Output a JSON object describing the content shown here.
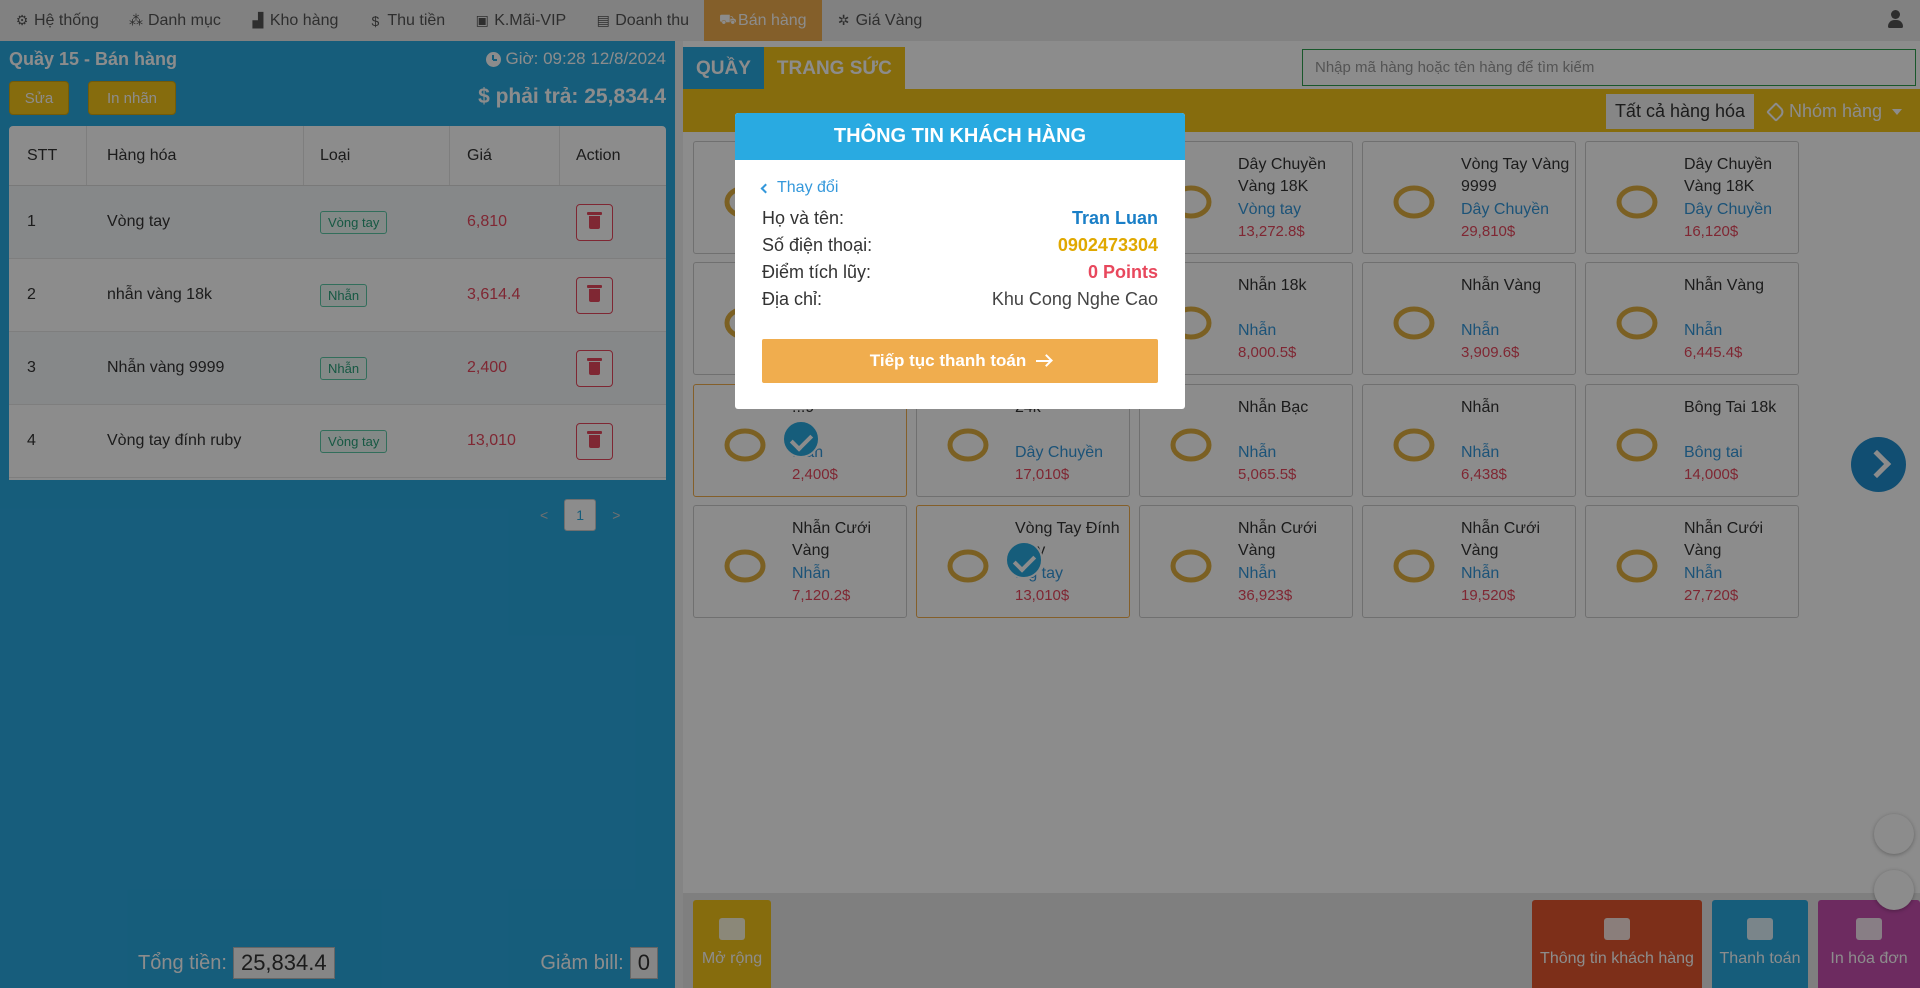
{
  "nav": {
    "items": [
      {
        "label": "Hệ thống",
        "icon": "gear-icon",
        "glyph": "⚙"
      },
      {
        "label": "Danh mục",
        "icon": "cubes-icon",
        "glyph": "⁂"
      },
      {
        "label": "Kho hàng",
        "icon": "industry-icon",
        "glyph": "▟"
      },
      {
        "label": "Thu tiền",
        "icon": "dollar-icon",
        "glyph": "$"
      },
      {
        "label": "K.Mãi-VIP",
        "icon": "gift-icon",
        "glyph": "▣"
      },
      {
        "label": "Doanh thu",
        "icon": "file-icon",
        "glyph": "▤"
      },
      {
        "label": "Bán hàng",
        "icon": "cart-icon",
        "glyph": "⛟"
      },
      {
        "label": "Giá Vàng",
        "icon": "bug-icon",
        "glyph": "✲"
      }
    ],
    "active_index": 6
  },
  "left": {
    "title": "Quầy 15 - Bán hàng",
    "time": "Giờ: 09:28 12/8/2024",
    "edit_label": "Sửa",
    "print_label_label": "In nhãn",
    "pay_due": "$ phải trả: 25,834.4",
    "table": {
      "headers": [
        "STT",
        "Hàng hóa",
        "Loại",
        "Giá",
        "Action"
      ],
      "rows": [
        {
          "stt": "1",
          "name": "Vòng tay",
          "type": "Vòng tay",
          "price": "6,810"
        },
        {
          "stt": "2",
          "name": "nhẫn vàng 18k",
          "type": "Nhẫn",
          "price": "3,614.4"
        },
        {
          "stt": "3",
          "name": "Nhẫn vàng 9999",
          "type": "Nhẫn",
          "price": "2,400"
        },
        {
          "stt": "4",
          "name": "Vòng tay đính ruby",
          "type": "Vòng tay",
          "price": "13,010"
        }
      ]
    },
    "pager": {
      "prev": "<",
      "page": "1",
      "next": ">"
    },
    "total_label": "Tổng tiền:",
    "total_value": "25,834.4",
    "discount_label": "Giảm bill:",
    "discount_value": "0"
  },
  "right": {
    "tab_counter": "QUẦY",
    "tab_jewelry": "TRANG SỨC",
    "search_placeholder": "Nhập mã hàng hoặc tên hàng để tìm kiếm",
    "all_goods": "Tất cả hàng hóa",
    "group_label": "Nhóm hàng",
    "products": [
      {
        "name": "",
        "type": "",
        "price": "",
        "selected": false
      },
      {
        "name": "",
        "type": "",
        "price": "",
        "selected": false
      },
      {
        "name": "Dây Chuyền Vàng 18K",
        "type": "Vòng tay",
        "price": "13,272.8$",
        "selected": false
      },
      {
        "name": "Vòng Tay Vàng 9999",
        "type": "Dây Chuyền",
        "price": "29,810$",
        "selected": false
      },
      {
        "name": "Dây Chuyền Vàng 18K",
        "type": "Dây Chuyền",
        "price": "16,120$",
        "selected": false
      },
      {
        "name": "",
        "type": "",
        "price": "",
        "selected": false
      },
      {
        "name": "",
        "type": "",
        "price": "",
        "selected": false
      },
      {
        "name": "Nhẫn 18k",
        "type": "Nhẫn",
        "price": "8,000.5$",
        "selected": false
      },
      {
        "name": "Nhẫn Vàng",
        "type": "Nhẫn",
        "price": "3,909.6$",
        "selected": false
      },
      {
        "name": "Nhẫn Vàng",
        "type": "Nhẫn",
        "price": "6,445.4$",
        "selected": false
      },
      {
        "name": "...9",
        "type": "...ẫn",
        "price": "2,400$",
        "selected": true
      },
      {
        "name": "24k",
        "type": "Dây Chuyền",
        "price": "17,010$",
        "selected": false
      },
      {
        "name": "Nhẫn Bạc",
        "type": "Nhẫn",
        "price": "5,065.5$",
        "selected": false
      },
      {
        "name": "Nhẫn",
        "type": "Nhẫn",
        "price": "6,438$",
        "selected": false
      },
      {
        "name": "Bông Tai 18k",
        "type": "Bông tai",
        "price": "14,000$",
        "selected": false
      },
      {
        "name": "Nhẫn Cưới Vàng",
        "type": "Nhẫn",
        "price": "7,120.2$",
        "selected": false
      },
      {
        "name": "Vòng Tay Đính ...by",
        "type": "...g tay",
        "price": "13,010$",
        "selected": true
      },
      {
        "name": "Nhẫn Cưới Vàng",
        "type": "Nhẫn",
        "price": "36,923$",
        "selected": false
      },
      {
        "name": "Nhẫn Cưới Vàng",
        "type": "Nhẫn",
        "price": "19,520$",
        "selected": false
      },
      {
        "name": "Nhẫn Cưới Vàng",
        "type": "Nhẫn",
        "price": "27,720$",
        "selected": false
      }
    ],
    "expand_label": "Mở rộng",
    "customer_info_label": "Thông tin khách hàng",
    "pay_label": "Thanh toán",
    "print_invoice_label": "In hóa đơn"
  },
  "modal": {
    "title": "THÔNG TIN KHÁCH HÀNG",
    "change_label": "Thay đổi",
    "name_label": "Họ và tên:",
    "name_value": "Tran Luan",
    "phone_label": "Số điện thoại:",
    "phone_value": "0902473304",
    "points_label": "Điểm tích lũy:",
    "points_value": "0 Points",
    "address_label": "Địa chỉ:",
    "address_value": "Khu Cong Nghe Cao",
    "continue_label": "Tiếp tục thanh toán"
  },
  "colors": {
    "primary_blue": "#29aae1",
    "yellow": "#f5c518",
    "orange": "#f0ad4e",
    "red": "#e8485d",
    "btn_customer": "#e4572e",
    "btn_pay": "#29aae1",
    "btn_print": "#c74fb0"
  }
}
